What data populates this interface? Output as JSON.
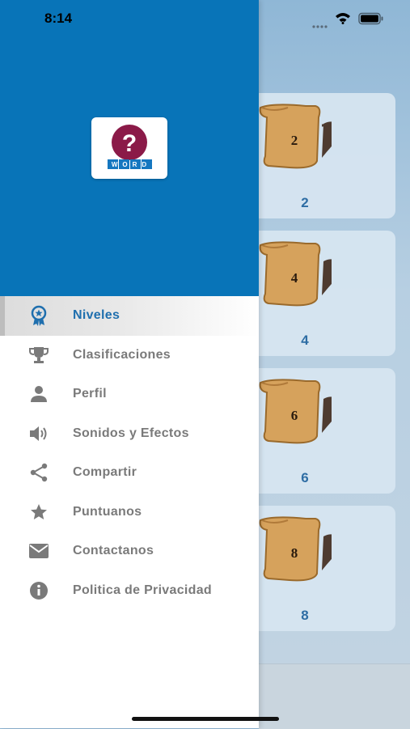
{
  "status_bar": {
    "time": "8:14"
  },
  "app": {
    "logo_text": "WORD"
  },
  "drawer": {
    "items": [
      {
        "label": "Niveles",
        "icon": "badge-icon",
        "active": true
      },
      {
        "label": "Clasificaciones",
        "icon": "trophy-icon"
      },
      {
        "label": "Perfil",
        "icon": "person-icon"
      },
      {
        "label": "Sonidos y Efectos",
        "icon": "speaker-icon"
      },
      {
        "label": "Compartir",
        "icon": "share-icon"
      },
      {
        "label": "Puntuanos",
        "icon": "star-icon"
      },
      {
        "label": "Contactanos",
        "icon": "mail-icon"
      },
      {
        "label": "Politica de Privacidad",
        "icon": "info-icon"
      }
    ]
  },
  "levels": [
    {
      "scroll_number": "2",
      "label": "2"
    },
    {
      "scroll_number": "4",
      "label": "4"
    },
    {
      "scroll_number": "6",
      "label": "6"
    },
    {
      "scroll_number": "8",
      "label": "8"
    }
  ],
  "colors": {
    "primary": "#0874b8",
    "active_text": "#1f6fae",
    "menu_text": "#7a7a7a",
    "logo_circle": "#8b1a48"
  }
}
